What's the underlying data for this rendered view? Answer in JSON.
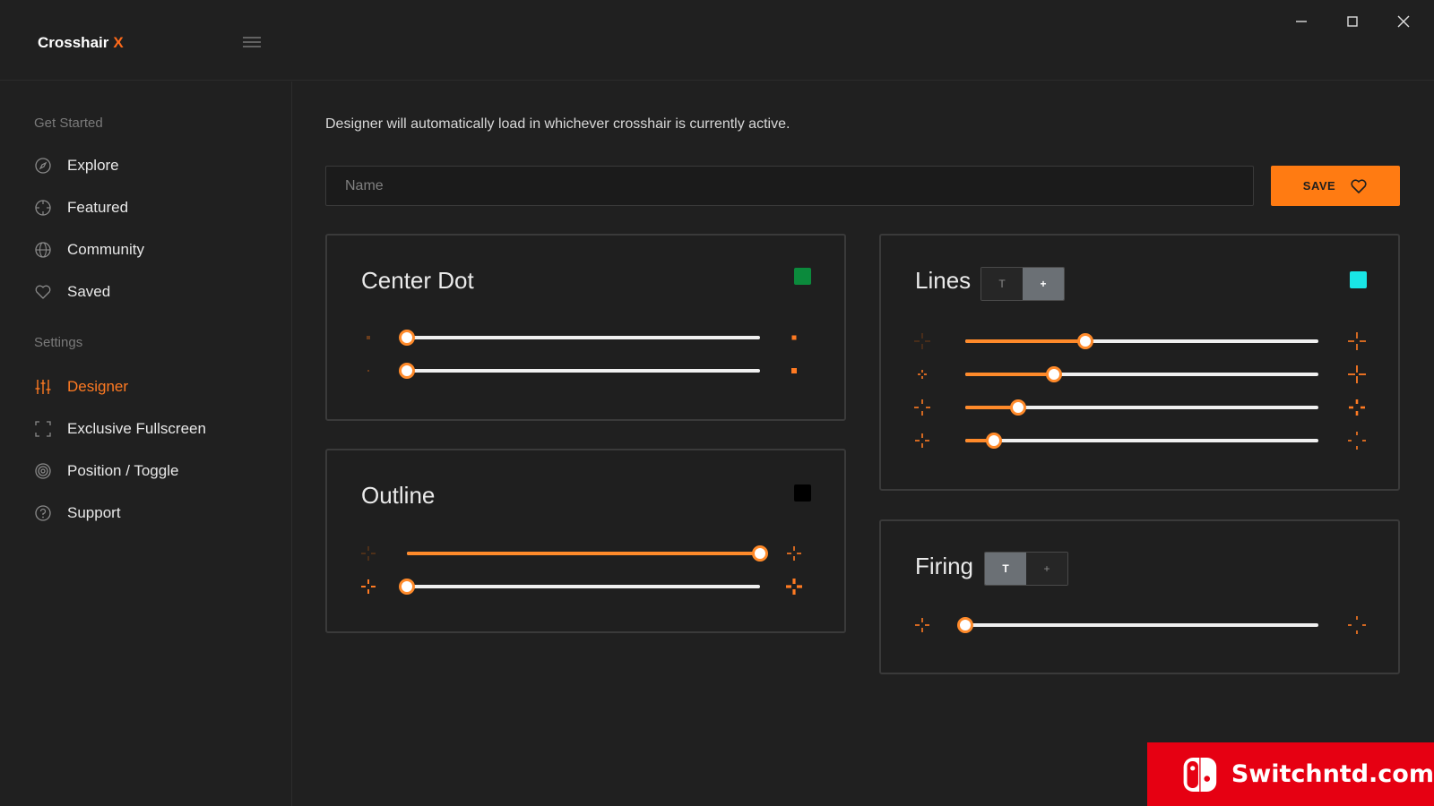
{
  "app": {
    "title": "Crosshair",
    "title_accent": "X"
  },
  "window_controls": [
    "minimize-icon",
    "maximize-icon",
    "close-icon"
  ],
  "sidebar": {
    "sections": [
      {
        "label": "Get Started",
        "items": [
          {
            "label": "Explore",
            "icon": "compass-icon"
          },
          {
            "label": "Featured",
            "icon": "crosshair-icon"
          },
          {
            "label": "Community",
            "icon": "globe-icon"
          },
          {
            "label": "Saved",
            "icon": "heart-icon"
          }
        ]
      },
      {
        "label": "Settings",
        "items": [
          {
            "label": "Designer",
            "icon": "sliders-icon",
            "active": true
          },
          {
            "label": "Exclusive Fullscreen",
            "icon": "fullscreen-icon"
          },
          {
            "label": "Position / Toggle",
            "icon": "target-icon"
          },
          {
            "label": "Support",
            "icon": "help-icon"
          }
        ]
      }
    ]
  },
  "main": {
    "info": "Designer will automatically load in whichever crosshair is currently active.",
    "name_placeholder": "Name",
    "name_value": "",
    "save_label": "SAVE"
  },
  "panels": {
    "center_dot": {
      "title": "Center Dot",
      "color": "#0b8a3c",
      "sliders": [
        0.0,
        0.0
      ]
    },
    "outline": {
      "title": "Outline",
      "color": "#000000",
      "sliders": [
        1.0,
        0.0
      ]
    },
    "lines": {
      "title": "Lines",
      "color": "#19e6e6",
      "toggle": [
        "T",
        "+"
      ],
      "toggle_selected": "+",
      "sliders": [
        0.34,
        0.25,
        0.15,
        0.08
      ]
    },
    "firing": {
      "title": "Firing",
      "toggle": [
        "T",
        "+"
      ],
      "toggle_selected": "T",
      "sliders": [
        0.0
      ]
    }
  },
  "colors": {
    "accent": "#ff7b12",
    "background": "#202020"
  },
  "watermark": {
    "text": "Switchntd.com"
  }
}
